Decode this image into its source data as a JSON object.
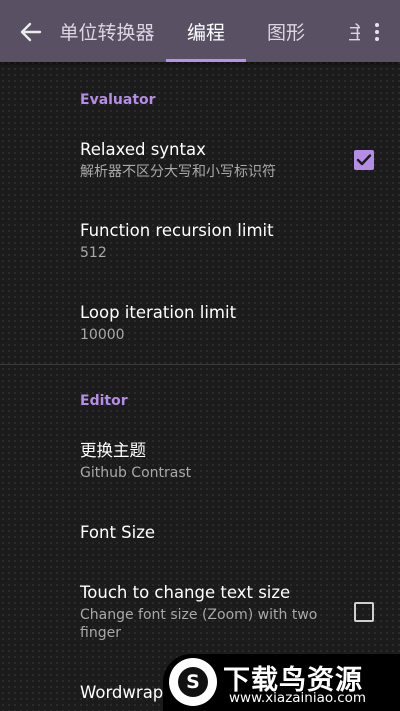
{
  "appbar": {
    "back_icon": "arrow-left-icon",
    "tabs": [
      {
        "label": "单位转换器"
      },
      {
        "label": "编程"
      },
      {
        "label": "图形"
      },
      {
        "label": "主"
      }
    ],
    "active_tab": 1,
    "more_icon": "more-vert-icon"
  },
  "colors": {
    "appbar": "#595063",
    "accent": "#b38ee4",
    "background": "#1b1b1b"
  },
  "settings": {
    "evaluator": {
      "header": "Evaluator",
      "relaxed_syntax": {
        "title": "Relaxed syntax",
        "summary": "解析器不区分大写和小写标识符",
        "checked": true
      },
      "function_recursion": {
        "title": "Function recursion limit",
        "summary": "512"
      },
      "loop_iteration": {
        "title": "Loop iteration limit",
        "summary": "10000"
      }
    },
    "editor": {
      "header": "Editor",
      "theme": {
        "title": "更换主题",
        "summary": "Github Contrast"
      },
      "font_size": {
        "title": "Font Size"
      },
      "touch_text_size": {
        "title": "Touch to change text size",
        "summary": "Change font size (Zoom) with two finger",
        "checked": false
      },
      "wordwrap": {
        "title": "Wordwrap"
      }
    }
  },
  "watermark": {
    "logo_glyph": "S",
    "title": "下载鸟资源",
    "url": "www.xiazainiao.com"
  }
}
